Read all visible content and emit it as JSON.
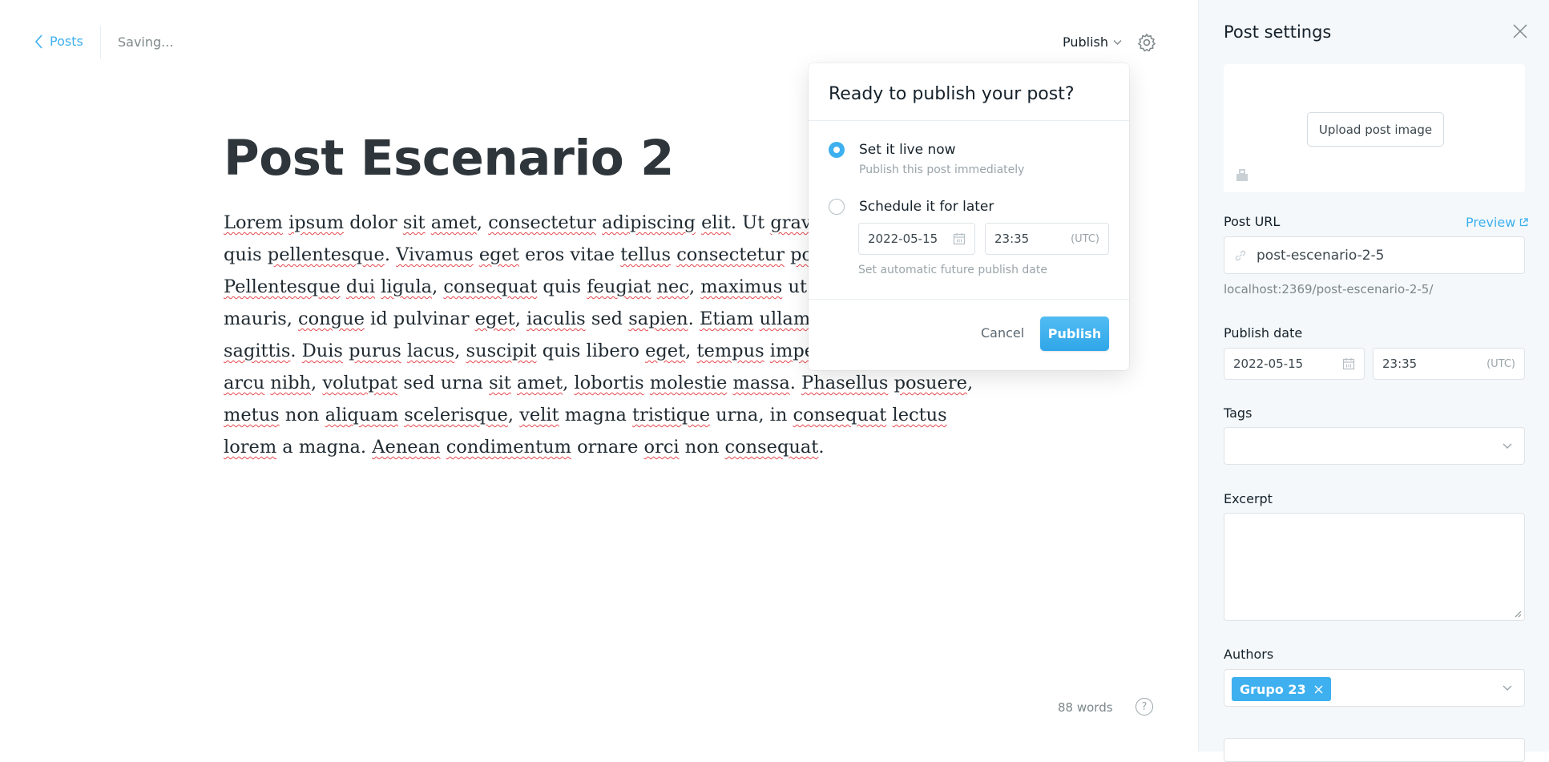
{
  "header": {
    "back_label": "Posts",
    "status": "Saving...",
    "publish_menu_label": "Publish"
  },
  "post": {
    "title": "Post Escenario 2",
    "body_lines": [
      [
        [
          "Lorem",
          true
        ],
        [
          " ",
          false
        ],
        [
          "ipsum",
          true
        ],
        [
          " dolor ",
          false
        ],
        [
          "sit",
          true
        ],
        [
          " ",
          false
        ],
        [
          "amet",
          true
        ],
        [
          ", ",
          false
        ],
        [
          "consectetur",
          true
        ],
        [
          " ",
          false
        ],
        [
          "adipiscing",
          true
        ],
        [
          " ",
          false
        ],
        [
          "elit",
          true
        ],
        [
          ". Ut ",
          false
        ],
        [
          "gravid",
          true
        ]
      ],
      [
        [
          "quis",
          false
        ],
        [
          " ",
          false
        ],
        [
          "pellentesque",
          true
        ],
        [
          ". ",
          false
        ],
        [
          "Vivamus",
          true
        ],
        [
          " ",
          false
        ],
        [
          "eget",
          true
        ],
        [
          " eros vitae ",
          false
        ],
        [
          "tellus",
          true
        ],
        [
          " ",
          false
        ],
        [
          "consectetur",
          true
        ],
        [
          " ",
          false
        ],
        [
          "portt",
          true
        ]
      ],
      [
        [
          "Pellentesque",
          true
        ],
        [
          " ",
          false
        ],
        [
          "dui",
          true
        ],
        [
          " ",
          false
        ],
        [
          "ligula",
          true
        ],
        [
          ", ",
          false
        ],
        [
          "consequat",
          true
        ],
        [
          " quis ",
          false
        ],
        [
          "feugiat",
          true
        ],
        [
          " ",
          false
        ],
        [
          "nec",
          true
        ],
        [
          ", ",
          false
        ],
        [
          "maximus",
          true
        ],
        [
          " ut to",
          false
        ]
      ],
      [
        [
          "mauris, ",
          false
        ],
        [
          "congue",
          true
        ],
        [
          " id pulvinar ",
          false
        ],
        [
          "eget",
          true
        ],
        [
          ", ",
          false
        ],
        [
          "iaculis",
          true
        ],
        [
          " sed ",
          false
        ],
        [
          "sapien",
          true
        ],
        [
          ". ",
          false
        ],
        [
          "Etiam",
          true
        ],
        [
          " ",
          false
        ],
        [
          "ullamco",
          true
        ]
      ],
      [
        [
          "sagittis",
          true
        ],
        [
          ". ",
          false
        ],
        [
          "Duis",
          true
        ],
        [
          " ",
          false
        ],
        [
          "purus",
          true
        ],
        [
          " ",
          false
        ],
        [
          "lacus",
          true
        ],
        [
          ", ",
          false
        ],
        [
          "suscipit",
          true
        ],
        [
          " quis libero ",
          false
        ],
        [
          "eget",
          true
        ],
        [
          ", ",
          false
        ],
        [
          "tempus",
          true
        ],
        [
          " ",
          false
        ],
        [
          "imperd",
          true
        ]
      ],
      [
        [
          "arcu",
          true
        ],
        [
          " ",
          false
        ],
        [
          "nibh",
          true
        ],
        [
          ", ",
          false
        ],
        [
          "volutpat",
          true
        ],
        [
          " sed urna ",
          false
        ],
        [
          "sit",
          true
        ],
        [
          " ",
          false
        ],
        [
          "amet",
          true
        ],
        [
          ", ",
          false
        ],
        [
          "lobortis",
          true
        ],
        [
          " ",
          false
        ],
        [
          "molestie",
          true
        ],
        [
          " ",
          false
        ],
        [
          "massa",
          true
        ],
        [
          ". ",
          false
        ],
        [
          "Phasellus",
          true
        ],
        [
          " ",
          false
        ],
        [
          "posuere",
          true
        ],
        [
          ",",
          false
        ]
      ],
      [
        [
          "metus",
          true
        ],
        [
          " non ",
          false
        ],
        [
          "aliquam",
          true
        ],
        [
          " ",
          false
        ],
        [
          "scelerisque",
          true
        ],
        [
          ", ",
          false
        ],
        [
          "velit",
          true
        ],
        [
          " magna ",
          false
        ],
        [
          "tristique",
          true
        ],
        [
          " urna, in ",
          false
        ],
        [
          "consequat",
          true
        ],
        [
          " ",
          false
        ],
        [
          "lectus",
          true
        ]
      ],
      [
        [
          "lorem",
          true
        ],
        [
          " a magna. ",
          false
        ],
        [
          "Aenean",
          true
        ],
        [
          " ",
          false
        ],
        [
          "condimentum",
          true
        ],
        [
          " ornare ",
          false
        ],
        [
          "orci",
          true
        ],
        [
          " non ",
          false
        ],
        [
          "consequat",
          true
        ],
        [
          ".",
          false
        ]
      ]
    ],
    "word_count": "88 words"
  },
  "publish_popover": {
    "heading": "Ready to publish your post?",
    "option_now": {
      "label": "Set it live now",
      "description": "Publish this post immediately",
      "selected": true
    },
    "option_later": {
      "label": "Schedule it for later",
      "date": "2022-05-15",
      "time": "23:35",
      "timezone": "(UTC)",
      "hint": "Set automatic future publish date",
      "selected": false
    },
    "cancel_label": "Cancel",
    "publish_label": "Publish"
  },
  "sidebar": {
    "title": "Post settings",
    "upload_label": "Upload post image",
    "post_url_label": "Post URL",
    "preview_label": "Preview",
    "post_url_value": "post-escenario-2-5",
    "post_url_full": "localhost:2369/post-escenario-2-5/",
    "publish_date_label": "Publish date",
    "publish_date": "2022-05-15",
    "publish_time": "23:35",
    "timezone": "(UTC)",
    "tags_label": "Tags",
    "excerpt_label": "Excerpt",
    "authors_label": "Authors",
    "authors": [
      "Grupo 23"
    ]
  },
  "colors": {
    "accent": "#3eb0ef",
    "spellcheck": "#e5484d"
  }
}
